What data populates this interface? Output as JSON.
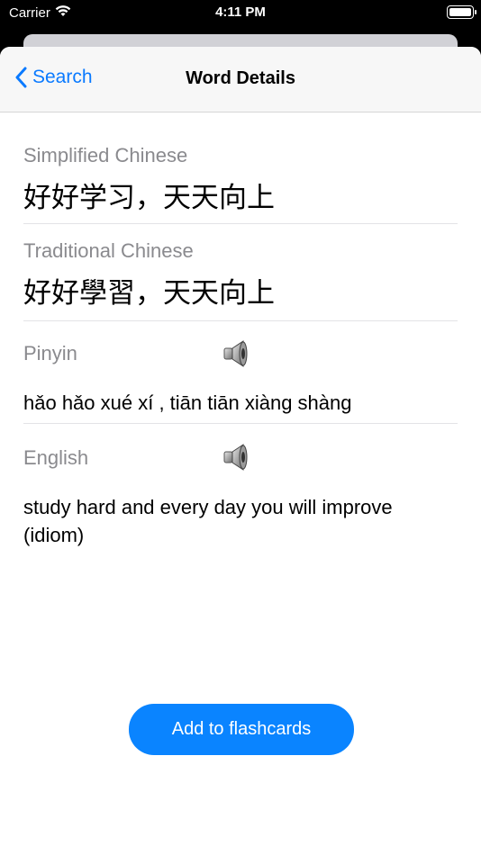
{
  "status": {
    "carrier": "Carrier",
    "time": "4:11 PM"
  },
  "nav": {
    "back_label": "Search",
    "title": "Word Details"
  },
  "fields": {
    "simplified": {
      "label": "Simplified Chinese",
      "value": "好好学习，天天向上"
    },
    "traditional": {
      "label": "Traditional Chinese",
      "value": "好好學習，天天向上"
    },
    "pinyin": {
      "label": "Pinyin",
      "value": "hǎo hǎo xué xí , tiān tiān xiàng shàng"
    },
    "english": {
      "label": "English",
      "value": "study hard and every day you will improve (idiom)"
    }
  },
  "actions": {
    "add_flashcards": "Add to flashcards"
  },
  "colors": {
    "accent": "#0a84ff",
    "label_gray": "#8a8a8e"
  },
  "icons": {
    "back": "chevron-left-icon",
    "audio": "speaker-icon",
    "wifi": "wifi-icon",
    "battery": "battery-icon"
  }
}
